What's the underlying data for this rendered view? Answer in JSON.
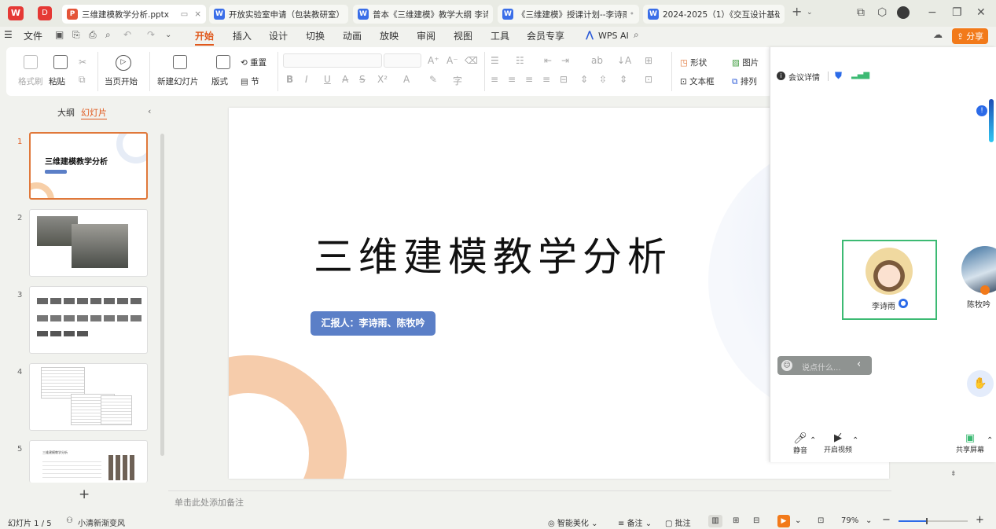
{
  "tabs": [
    {
      "label": "三维建模教学分析.pptx",
      "type": "P",
      "active": true
    },
    {
      "label": "开放实验室申请（包装教研室）.d",
      "type": "W"
    },
    {
      "label": "普本《三维建模》教学大纲 李诗",
      "type": "W"
    },
    {
      "label": "《三维建模》授课计划--李诗雨",
      "type": "W"
    },
    {
      "label": "2024-2025（1）《交互设计基础",
      "type": "W"
    }
  ],
  "menu": {
    "file": "文件",
    "items": [
      "开始",
      "插入",
      "设计",
      "切换",
      "动画",
      "放映",
      "审阅",
      "视图",
      "工具",
      "会员专享"
    ],
    "wps_ai": "WPS AI",
    "share": "分享"
  },
  "ribbon": {
    "format_painter": "格式刷",
    "paste": "粘贴",
    "start_from_current": "当页开始",
    "new_slide": "新建幻灯片",
    "layout": "版式",
    "section": "节",
    "reset": "重置",
    "shape": "形状",
    "picture": "图片",
    "textbox": "文本框",
    "arrange": "排列"
  },
  "left_panel": {
    "tab_outline": "大纲",
    "tab_slides": "幻灯片",
    "slide_numbers": [
      "1",
      "2",
      "3",
      "4",
      "5"
    ],
    "slide1_title": "三维建模教学分析",
    "slide5_title": "三维建模教学分析",
    "add": "+"
  },
  "slide": {
    "title": "三维建模教学分析",
    "reporter": "汇报人：李诗雨、陈牧吟"
  },
  "notes_placeholder": "单击此处添加备注",
  "meeting": {
    "details": "会议详情",
    "participants": [
      {
        "name": "李诗雨"
      },
      {
        "name": "陈牧吟"
      }
    ],
    "chat_placeholder": "说点什么...",
    "mute": "静音",
    "start_video": "开启视频",
    "share_screen": "共享屏幕"
  },
  "status": {
    "slide_count": "幻灯片 1 / 5",
    "theme": "小清新渐变风",
    "beautify": "智能美化",
    "notes": "备注",
    "comments": "批注",
    "zoom": "79%",
    "zoom_fraction": 0.4
  },
  "colors": {
    "accent": "#e0581c",
    "share": "#f27a1a",
    "reporter_bg": "#5b7fc7",
    "speaker_border": "#3cba73"
  }
}
